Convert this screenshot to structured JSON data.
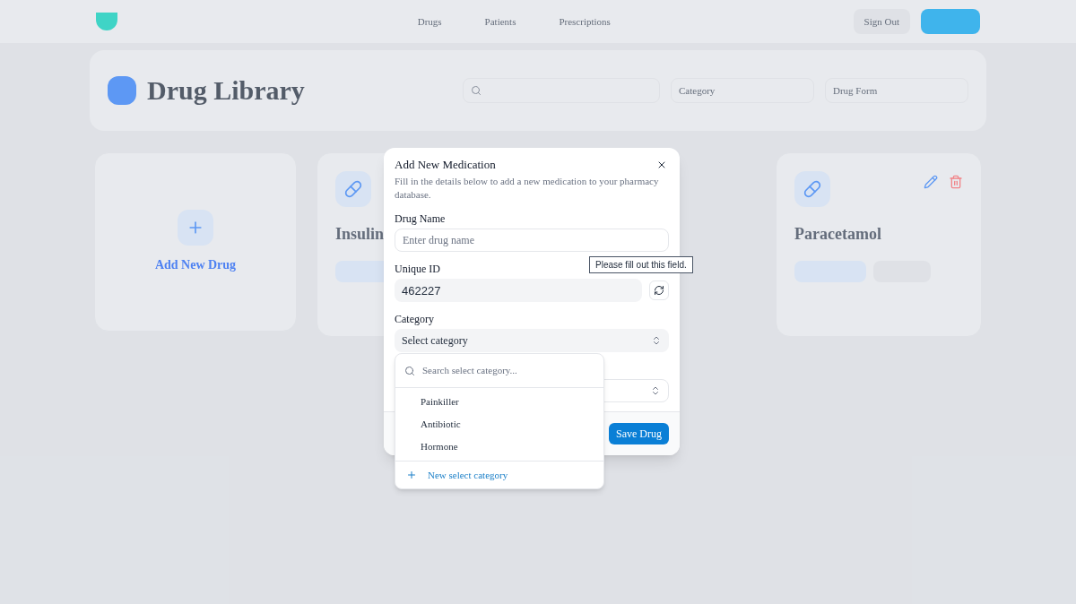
{
  "nav": {
    "links": [
      {
        "label": "Drugs"
      },
      {
        "label": "Patients"
      },
      {
        "label": "Prescriptions"
      }
    ],
    "sign_out": "Sign Out"
  },
  "header": {
    "title": "Drug Library",
    "category_filter": "Category",
    "form_filter": "Drug Form"
  },
  "cards": [
    {
      "kind": "add",
      "title": "Add New Drug"
    },
    {
      "kind": "drug",
      "name": "Insulin"
    },
    {
      "kind": "drug",
      "name": "Paracetamol"
    }
  ],
  "dialog": {
    "title": "Add New Medication",
    "description": "Fill in the details below to add a new medication to your pharmacy database.",
    "fields": [
      {
        "kind": "text",
        "label": "Drug Name",
        "placeholder": "Enter drug name"
      },
      {
        "kind": "id",
        "label": "Unique ID",
        "value": "462227"
      },
      {
        "kind": "select",
        "label": "Category",
        "value": "Select category"
      }
    ],
    "save": "Save Drug"
  },
  "tooltip": "Please fill out this field.",
  "dropdown": {
    "placeholder": "Search select category...",
    "options": [
      {
        "label": "Painkiller"
      },
      {
        "label": "Antibiotic"
      },
      {
        "label": "Hormone"
      }
    ],
    "add": "New select category"
  }
}
